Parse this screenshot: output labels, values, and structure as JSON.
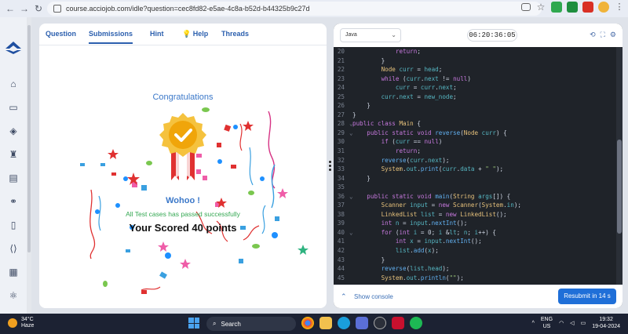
{
  "browser": {
    "url": "course.acciojob.com/idle?question=cec8fd82-e5ae-4c8a-b52d-b44325b9c27d"
  },
  "tabs": [
    "Question",
    "Submissions",
    "Hint",
    "Help",
    "Threads"
  ],
  "result": {
    "congrats": "Congratulations",
    "wohoo": "Wohoo !",
    "passed": "All Test cases has passed successfully",
    "score": "Your Scored 40 points"
  },
  "editor": {
    "language": "Java",
    "timer": "06:20:36:05",
    "show_console": "Show console",
    "resubmit": "Resubmit in 14 s",
    "lines": [
      {
        "n": "20",
        "f": "",
        "t": "            return;"
      },
      {
        "n": "21",
        "f": "",
        "t": "        }"
      },
      {
        "n": "22",
        "f": "",
        "t": "        Node curr = head;"
      },
      {
        "n": "23",
        "f": "",
        "t": "        while (curr.next != null)"
      },
      {
        "n": "24",
        "f": "",
        "t": "            curr = curr.next;"
      },
      {
        "n": "25",
        "f": "",
        "t": "        curr.next = new_node;"
      },
      {
        "n": "26",
        "f": "",
        "t": "    }"
      },
      {
        "n": "27",
        "f": "",
        "t": "}"
      },
      {
        "n": "28",
        "f": "v",
        "t": "public class Main {"
      },
      {
        "n": "29",
        "f": "v",
        "t": "    public static void reverse(Node curr) {"
      },
      {
        "n": "30",
        "f": "",
        "t": "        if (curr == null)"
      },
      {
        "n": "31",
        "f": "",
        "t": "            return;"
      },
      {
        "n": "32",
        "f": "",
        "t": "        reverse(curr.next);"
      },
      {
        "n": "33",
        "f": "",
        "t": "        System.out.print(curr.data + \" \");"
      },
      {
        "n": "34",
        "f": "",
        "t": "    }"
      },
      {
        "n": "35",
        "f": "",
        "t": ""
      },
      {
        "n": "36",
        "f": "v",
        "t": "    public static void main(String args[]) {"
      },
      {
        "n": "37",
        "f": "",
        "t": "        Scanner input = new Scanner(System.in);"
      },
      {
        "n": "38",
        "f": "",
        "t": "        LinkedList list = new LinkedList();"
      },
      {
        "n": "39",
        "f": "",
        "t": "        int n = input.nextInt();"
      },
      {
        "n": "40",
        "f": "v",
        "t": "        for (int i = 0; i < n; i++) {"
      },
      {
        "n": "41",
        "f": "",
        "t": "            int x = input.nextInt();"
      },
      {
        "n": "42",
        "f": "",
        "t": "            list.add(x);"
      },
      {
        "n": "43",
        "f": "",
        "t": "        }"
      },
      {
        "n": "44",
        "f": "",
        "t": "        reverse(list.head);"
      },
      {
        "n": "45",
        "f": "",
        "t": "        System.out.println(\"\");"
      }
    ]
  },
  "taskbar": {
    "temp": "34°C",
    "weather": "Haze",
    "search": "Search",
    "lang": "ENG",
    "region": "US",
    "time": "19:32",
    "date": "19-04-2024"
  },
  "colors": {
    "accent": "#2b5fae",
    "success": "#35a853",
    "editor_bg": "#1f2329",
    "button": "#1f6fd8"
  }
}
